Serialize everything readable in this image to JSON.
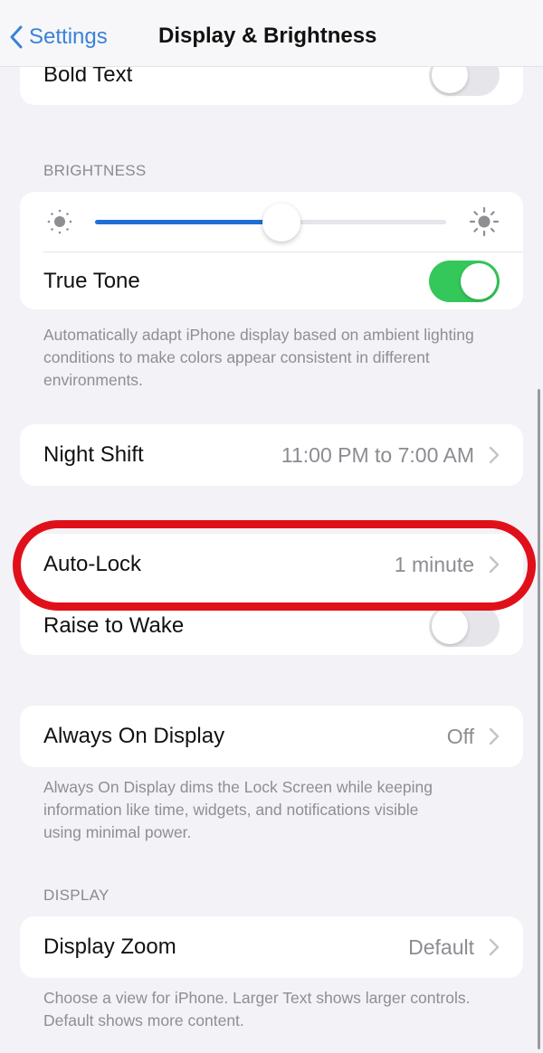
{
  "nav": {
    "back_label": "Settings",
    "title": "Display & Brightness"
  },
  "bold_text": {
    "label": "Bold Text",
    "enabled": false
  },
  "brightness": {
    "header": "BRIGHTNESS",
    "level": 0.53,
    "true_tone": {
      "label": "True Tone",
      "enabled": true
    },
    "footer": "Automatically adapt iPhone display based on ambient lighting conditions to make colors appear consistent in different environments."
  },
  "night_shift": {
    "label": "Night Shift",
    "value": "11:00 PM to 7:00 AM"
  },
  "auto_lock": {
    "label": "Auto-Lock",
    "value": "1 minute",
    "highlighted": true
  },
  "raise_to_wake": {
    "label": "Raise to Wake",
    "enabled": false
  },
  "always_on": {
    "label": "Always On Display",
    "value": "Off",
    "footer": "Always On Display dims the Lock Screen while keeping information like time, widgets, and notifications visible using minimal power."
  },
  "display": {
    "header": "DISPLAY",
    "zoom_label": "Display Zoom",
    "zoom_value": "Default",
    "footer": "Choose a view for iPhone. Larger Text shows larger controls. Default shows more content."
  },
  "colors": {
    "accent": "#3a82d8",
    "toggle_on": "#34c759",
    "slider_fill": "#1f6fd6",
    "highlight": "#e0101a"
  },
  "icons": {
    "back": "chevron-left-icon",
    "disclosure": "chevron-right-icon",
    "brightness_low": "sun-small-icon",
    "brightness_high": "sun-large-icon"
  }
}
